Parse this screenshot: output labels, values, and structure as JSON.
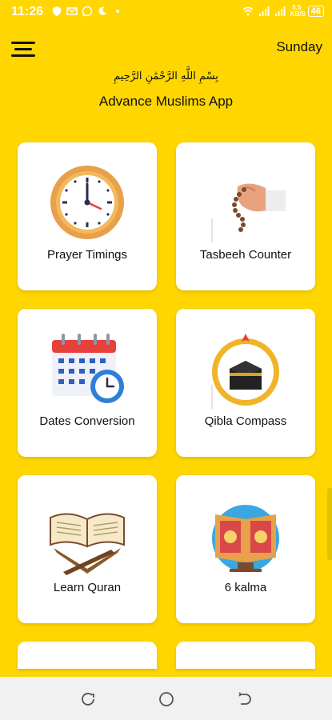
{
  "status": {
    "time": "11:26",
    "right_text": "5.5 KB/S",
    "battery": "46"
  },
  "header": {
    "day": "Sunday",
    "bismillah": "بِسْمِ اللَّهِ الرَّحْمَٰنِ الرَّحِيمِ",
    "title": "Advance Muslims App"
  },
  "cards": [
    {
      "label": "Prayer Timings",
      "icon": "clock-icon"
    },
    {
      "label": "Tasbeeh Counter",
      "icon": "tasbeeh-icon"
    },
    {
      "label": "Dates Conversion",
      "icon": "calendar-icon"
    },
    {
      "label": "Qibla Compass",
      "icon": "kaaba-compass-icon"
    },
    {
      "label": "Learn Quran",
      "icon": "quran-icon"
    },
    {
      "label": "6 kalma",
      "icon": "kalma-book-icon"
    }
  ],
  "colors": {
    "background": "#FFD600",
    "card": "#FFFFFF"
  }
}
